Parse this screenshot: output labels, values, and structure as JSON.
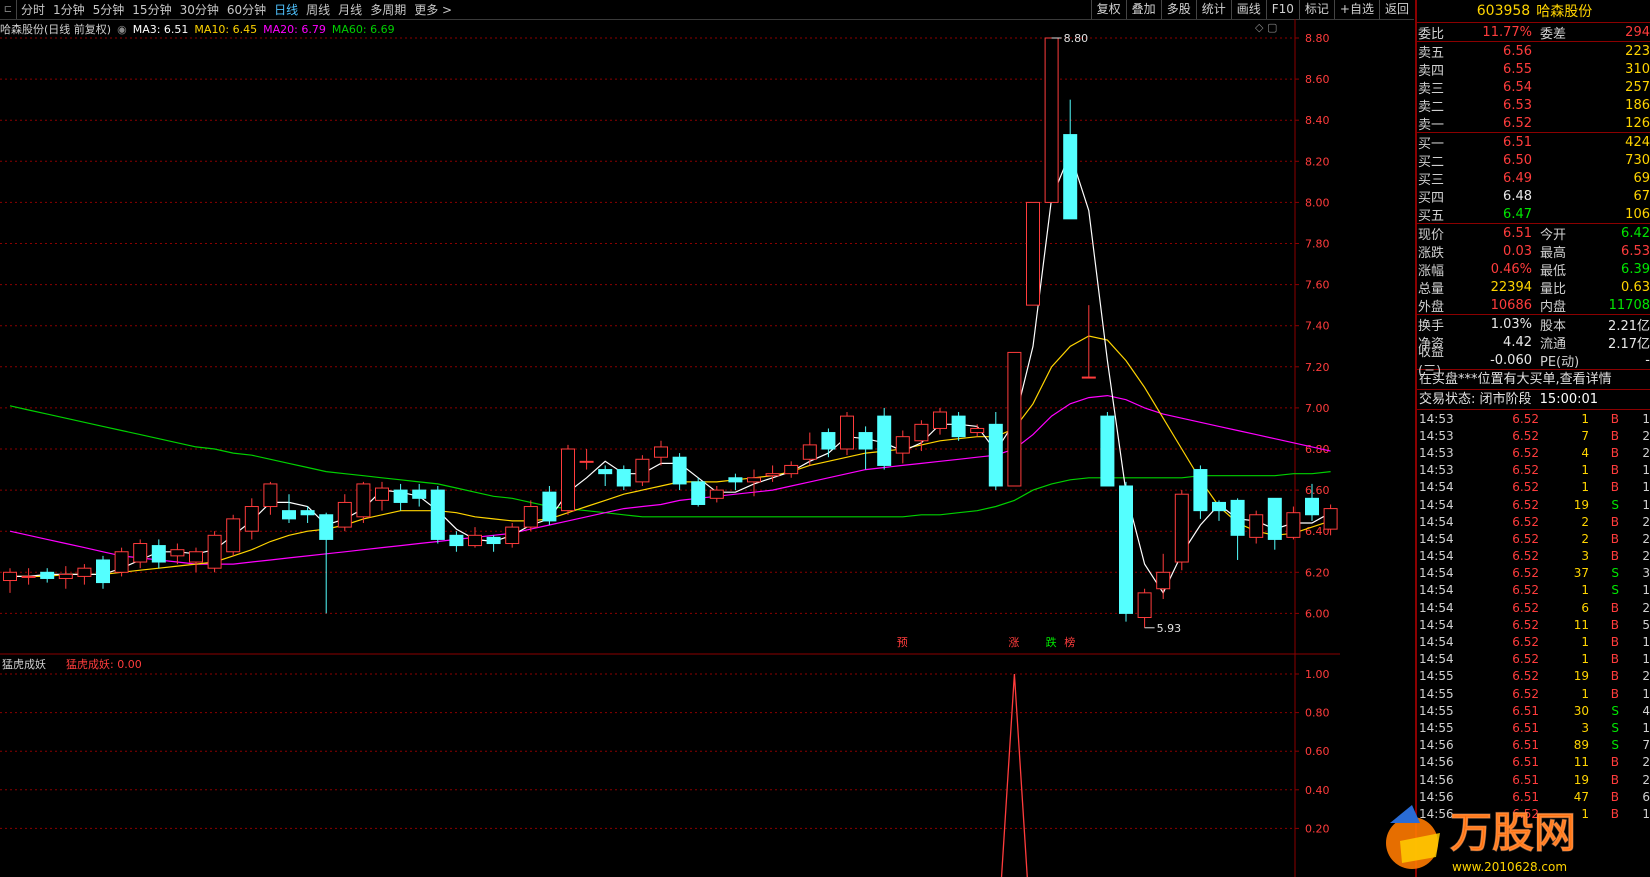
{
  "toolbar": {
    "periods": [
      "分时",
      "1分钟",
      "5分钟",
      "15分钟",
      "30分钟",
      "60分钟",
      "日线",
      "周线",
      "月线",
      "多周期",
      "更多 >"
    ],
    "active_period": "日线",
    "tools": [
      "复权",
      "叠加",
      "多股",
      "统计",
      "画线",
      "F10",
      "标记",
      "+自选",
      "返回"
    ]
  },
  "info": {
    "title": "哈森股份(日线 前复权)",
    "ma3": "MA3: 6.51",
    "ma10": "MA10: 6.45",
    "ma20": "MA20: 6.79",
    "ma60": "MA60: 6.69"
  },
  "indicator": {
    "name": "猛虎成妖",
    "label": "猛虎成妖: 0.00"
  },
  "colors": {
    "up": "#ff3c3c",
    "down": "#54ffff",
    "ma3": "#ffffff",
    "ma10": "#ffd400",
    "ma20": "#ff00ff",
    "ma60": "#00d000",
    "grid": "#8b0000"
  },
  "chart_data": {
    "type": "candlestick",
    "ylim": [
      5.93,
      8.8
    ],
    "yticks": [
      "8.80",
      "8.60",
      "8.40",
      "8.20",
      "8.00",
      "7.80",
      "7.60",
      "7.40",
      "7.20",
      "7.00",
      "6.80",
      "6.60",
      "6.40",
      "6.20",
      "6.00"
    ],
    "max_label": "8.80",
    "min_label": "5.93",
    "signals": [
      {
        "text": "预",
        "color": "#ff3c3c",
        "idx": 48
      },
      {
        "text": "涨",
        "color": "#ff3c3c",
        "idx": 54
      },
      {
        "text": "跌",
        "color": "#00e600",
        "idx": 56
      },
      {
        "text": "榜",
        "color": "#ff3c3c",
        "idx": 57
      }
    ],
    "candles": [
      [
        6.16,
        6.2,
        6.1,
        6.22
      ],
      [
        6.18,
        6.18,
        6.14,
        6.22
      ],
      [
        6.2,
        6.17,
        6.15,
        6.22
      ],
      [
        6.17,
        6.19,
        6.12,
        6.23
      ],
      [
        6.18,
        6.22,
        6.14,
        6.24
      ],
      [
        6.26,
        6.15,
        6.12,
        6.28
      ],
      [
        6.2,
        6.3,
        6.18,
        6.32
      ],
      [
        6.25,
        6.34,
        6.22,
        6.36
      ],
      [
        6.33,
        6.25,
        6.22,
        6.36
      ],
      [
        6.28,
        6.31,
        6.24,
        6.34
      ],
      [
        6.25,
        6.3,
        6.2,
        6.32
      ],
      [
        6.22,
        6.38,
        6.2,
        6.4
      ],
      [
        6.3,
        6.46,
        6.28,
        6.48
      ],
      [
        6.4,
        6.52,
        6.36,
        6.56
      ],
      [
        6.52,
        6.63,
        6.48,
        6.64
      ],
      [
        6.5,
        6.46,
        6.44,
        6.58
      ],
      [
        6.5,
        6.48,
        6.44,
        6.52
      ],
      [
        6.48,
        6.36,
        6.0,
        6.49
      ],
      [
        6.42,
        6.54,
        6.4,
        6.58
      ],
      [
        6.47,
        6.63,
        6.44,
        6.64
      ],
      [
        6.55,
        6.61,
        6.5,
        6.64
      ],
      [
        6.6,
        6.54,
        6.5,
        6.63
      ],
      [
        6.6,
        6.56,
        6.52,
        6.63
      ],
      [
        6.6,
        6.36,
        6.34,
        6.62
      ],
      [
        6.38,
        6.33,
        6.3,
        6.4
      ],
      [
        6.33,
        6.38,
        6.32,
        6.42
      ],
      [
        6.37,
        6.34,
        6.3,
        6.38
      ],
      [
        6.34,
        6.42,
        6.32,
        6.44
      ],
      [
        6.42,
        6.52,
        6.4,
        6.55
      ],
      [
        6.59,
        6.45,
        6.43,
        6.62
      ],
      [
        6.5,
        6.8,
        6.48,
        6.82
      ],
      [
        6.74,
        6.74,
        6.7,
        6.8
      ],
      [
        6.7,
        6.68,
        6.62,
        6.72
      ],
      [
        6.7,
        6.62,
        6.6,
        6.72
      ],
      [
        6.64,
        6.75,
        6.62,
        6.77
      ],
      [
        6.76,
        6.81,
        6.72,
        6.84
      ],
      [
        6.76,
        6.63,
        6.6,
        6.78
      ],
      [
        6.64,
        6.53,
        6.52,
        6.66
      ],
      [
        6.56,
        6.6,
        6.54,
        6.62
      ],
      [
        6.66,
        6.64,
        6.6,
        6.68
      ],
      [
        6.64,
        6.66,
        6.57,
        6.7
      ],
      [
        6.67,
        6.68,
        6.64,
        6.72
      ],
      [
        6.68,
        6.72,
        6.66,
        6.74
      ],
      [
        6.75,
        6.82,
        6.72,
        6.88
      ],
      [
        6.88,
        6.8,
        6.76,
        6.9
      ],
      [
        6.8,
        6.96,
        6.77,
        6.98
      ],
      [
        6.88,
        6.8,
        6.7,
        6.91
      ],
      [
        6.96,
        6.72,
        6.7,
        7.0
      ],
      [
        6.78,
        6.86,
        6.73,
        6.89
      ],
      [
        6.84,
        6.92,
        6.79,
        6.94
      ],
      [
        6.9,
        6.98,
        6.87,
        7.0
      ],
      [
        6.96,
        6.86,
        6.84,
        6.98
      ],
      [
        6.88,
        6.9,
        6.86,
        6.92
      ],
      [
        6.92,
        6.62,
        6.6,
        6.98
      ],
      [
        6.62,
        7.27,
        6.62,
        7.27
      ],
      [
        7.5,
        8.0,
        7.5,
        8.0
      ],
      [
        8.0,
        8.8,
        8.0,
        8.8
      ],
      [
        8.33,
        7.92,
        7.92,
        8.5
      ],
      [
        7.15,
        7.15,
        7.15,
        7.5
      ],
      [
        6.96,
        6.62,
        6.62,
        6.98
      ],
      [
        6.62,
        6.0,
        5.96,
        6.64
      ],
      [
        5.98,
        6.1,
        5.93,
        6.12
      ],
      [
        6.12,
        6.2,
        6.07,
        6.29
      ],
      [
        6.25,
        6.58,
        6.21,
        6.6
      ],
      [
        6.7,
        6.5,
        6.46,
        6.72
      ],
      [
        6.54,
        6.5,
        6.45,
        6.55
      ],
      [
        6.55,
        6.38,
        6.26,
        6.56
      ],
      [
        6.37,
        6.48,
        6.34,
        6.5
      ],
      [
        6.56,
        6.36,
        6.31,
        6.56
      ],
      [
        6.37,
        6.49,
        6.36,
        6.52
      ],
      [
        6.56,
        6.48,
        6.45,
        6.63
      ],
      [
        6.41,
        6.51,
        6.38,
        6.53
      ]
    ],
    "ma_series": {
      "ma3": [
        6.18,
        6.18,
        6.19,
        6.19,
        6.19,
        6.19,
        6.22,
        6.26,
        6.3,
        6.3,
        6.29,
        6.31,
        6.38,
        6.45,
        6.54,
        6.54,
        6.52,
        6.43,
        6.46,
        6.51,
        6.6,
        6.59,
        6.57,
        6.5,
        6.41,
        6.36,
        6.35,
        6.38,
        6.43,
        6.46,
        6.59,
        6.66,
        6.74,
        6.68,
        6.68,
        6.73,
        6.73,
        6.66,
        6.59,
        6.59,
        6.63,
        6.66,
        6.69,
        6.74,
        6.78,
        6.86,
        6.85,
        6.83,
        6.79,
        6.83,
        6.92,
        6.92,
        6.91,
        6.79,
        6.93,
        7.3,
        8.02,
        8.24,
        7.96,
        7.23,
        6.59,
        6.24,
        6.1,
        6.29,
        6.43,
        6.53,
        6.46,
        6.45,
        6.41,
        6.44,
        6.44,
        6.49
      ],
      "ma10": [
        6.18,
        6.18,
        6.18,
        6.19,
        6.19,
        6.19,
        6.2,
        6.21,
        6.22,
        6.23,
        6.24,
        6.25,
        6.28,
        6.31,
        6.35,
        6.38,
        6.4,
        6.41,
        6.43,
        6.46,
        6.48,
        6.5,
        6.5,
        6.5,
        6.49,
        6.47,
        6.46,
        6.45,
        6.45,
        6.46,
        6.49,
        6.52,
        6.55,
        6.58,
        6.6,
        6.62,
        6.64,
        6.64,
        6.64,
        6.65,
        6.66,
        6.67,
        6.69,
        6.72,
        6.74,
        6.76,
        6.78,
        6.79,
        6.8,
        6.82,
        6.84,
        6.85,
        6.86,
        6.86,
        6.9,
        7.02,
        7.2,
        7.3,
        7.35,
        7.33,
        7.23,
        7.1,
        6.95,
        6.8,
        6.65,
        6.52,
        6.44,
        6.4,
        6.38,
        6.39,
        6.42,
        6.45
      ],
      "ma20": [
        6.4,
        6.38,
        6.36,
        6.34,
        6.32,
        6.3,
        6.28,
        6.27,
        6.26,
        6.25,
        6.24,
        6.24,
        6.24,
        6.25,
        6.26,
        6.27,
        6.28,
        6.29,
        6.3,
        6.31,
        6.32,
        6.33,
        6.34,
        6.35,
        6.36,
        6.37,
        6.38,
        6.39,
        6.41,
        6.43,
        6.45,
        6.47,
        6.49,
        6.51,
        6.52,
        6.53,
        6.55,
        6.56,
        6.57,
        6.58,
        6.59,
        6.6,
        6.62,
        6.64,
        6.66,
        6.68,
        6.7,
        6.71,
        6.72,
        6.73,
        6.74,
        6.75,
        6.76,
        6.77,
        6.8,
        6.87,
        6.96,
        7.02,
        7.05,
        7.06,
        7.04,
        7.0,
        6.97,
        6.95,
        6.93,
        6.91,
        6.89,
        6.87,
        6.85,
        6.83,
        6.81,
        6.79
      ],
      "ma60": [
        7.01,
        6.99,
        6.97,
        6.95,
        6.93,
        6.91,
        6.89,
        6.87,
        6.85,
        6.83,
        6.81,
        6.8,
        6.78,
        6.77,
        6.75,
        6.73,
        6.71,
        6.69,
        6.68,
        6.67,
        6.66,
        6.65,
        6.64,
        6.63,
        6.61,
        6.59,
        6.57,
        6.56,
        6.54,
        6.52,
        6.51,
        6.5,
        6.49,
        6.48,
        6.47,
        6.47,
        6.47,
        6.47,
        6.47,
        6.47,
        6.47,
        6.47,
        6.47,
        6.47,
        6.47,
        6.47,
        6.47,
        6.47,
        6.47,
        6.48,
        6.48,
        6.49,
        6.5,
        6.52,
        6.55,
        6.6,
        6.63,
        6.65,
        6.66,
        6.66,
        6.66,
        6.66,
        6.66,
        6.66,
        6.67,
        6.67,
        6.67,
        6.67,
        6.67,
        6.68,
        6.68,
        6.69
      ]
    },
    "indicator": {
      "ylim": [
        0.2,
        1.0
      ],
      "yticks": [
        "1.00",
        "0.80",
        "0.60",
        "0.40",
        "0.20"
      ],
      "spike_index": 54,
      "spike_value": 1.0
    }
  },
  "quote": {
    "code": "603958",
    "name": "哈森股份",
    "weibi": {
      "label": "委比",
      "value": "11.77%",
      "label2": "委差",
      "value2": "294"
    },
    "sell": [
      {
        "label": "卖五",
        "price": "6.56",
        "vol": "223"
      },
      {
        "label": "卖四",
        "price": "6.55",
        "vol": "310"
      },
      {
        "label": "卖三",
        "price": "6.54",
        "vol": "257"
      },
      {
        "label": "卖二",
        "price": "6.53",
        "vol": "186"
      },
      {
        "label": "卖一",
        "price": "6.52",
        "vol": "126"
      }
    ],
    "buy": [
      {
        "label": "买一",
        "price": "6.51",
        "vol": "424"
      },
      {
        "label": "买二",
        "price": "6.50",
        "vol": "730"
      },
      {
        "label": "买三",
        "price": "6.49",
        "vol": "69"
      },
      {
        "label": "买四",
        "price": "6.48",
        "vol": "67"
      },
      {
        "label": "买五",
        "price": "6.47",
        "vol": "106"
      }
    ],
    "stats": [
      {
        "l1": "现价",
        "v1": "6.51",
        "l2": "今开",
        "v2": "6.42"
      },
      {
        "l1": "涨跌",
        "v1": "0.03",
        "l2": "最高",
        "v2": "6.53"
      },
      {
        "l1": "涨幅",
        "v1": "0.46%",
        "l2": "最低",
        "v2": "6.39"
      },
      {
        "l1": "总量",
        "v1": "22394",
        "l2": "量比",
        "v2": "0.63"
      },
      {
        "l1": "外盘",
        "v1": "10686",
        "l2": "内盘",
        "v2": "11708"
      }
    ],
    "stats2": [
      {
        "l1": "换手",
        "v1": "1.03%",
        "l2": "股本",
        "v2": "2.21亿"
      },
      {
        "l1": "净资",
        "v1": "4.42",
        "l2": "流通",
        "v2": "2.17亿"
      },
      {
        "l1": "收益(三)",
        "v1": "-0.060",
        "l2": "PE(动)",
        "v2": "-"
      }
    ],
    "notice": "在买盘***位置有大买单,查看详情",
    "status_label": "交易状态: 闭市阶段",
    "status_time": "15:00:01",
    "trades": [
      {
        "t": "14:53",
        "p": "6.52",
        "v": "1",
        "bs": "B",
        "n": "1"
      },
      {
        "t": "14:53",
        "p": "6.52",
        "v": "7",
        "bs": "B",
        "n": "2"
      },
      {
        "t": "14:53",
        "p": "6.52",
        "v": "4",
        "bs": "B",
        "n": "2"
      },
      {
        "t": "14:53",
        "p": "6.52",
        "v": "1",
        "bs": "B",
        "n": "1"
      },
      {
        "t": "14:54",
        "p": "6.52",
        "v": "1",
        "bs": "B",
        "n": "1"
      },
      {
        "t": "14:54",
        "p": "6.52",
        "v": "19",
        "bs": "S",
        "n": "1"
      },
      {
        "t": "14:54",
        "p": "6.52",
        "v": "2",
        "bs": "B",
        "n": "2"
      },
      {
        "t": "14:54",
        "p": "6.52",
        "v": "2",
        "bs": "B",
        "n": "2"
      },
      {
        "t": "14:54",
        "p": "6.52",
        "v": "3",
        "bs": "B",
        "n": "2"
      },
      {
        "t": "14:54",
        "p": "6.52",
        "v": "37",
        "bs": "S",
        "n": "3"
      },
      {
        "t": "14:54",
        "p": "6.52",
        "v": "1",
        "bs": "S",
        "n": "1"
      },
      {
        "t": "14:54",
        "p": "6.52",
        "v": "6",
        "bs": "B",
        "n": "2"
      },
      {
        "t": "14:54",
        "p": "6.52",
        "v": "11",
        "bs": "B",
        "n": "5"
      },
      {
        "t": "14:54",
        "p": "6.52",
        "v": "1",
        "bs": "B",
        "n": "1"
      },
      {
        "t": "14:54",
        "p": "6.52",
        "v": "1",
        "bs": "B",
        "n": "1"
      },
      {
        "t": "14:55",
        "p": "6.52",
        "v": "19",
        "bs": "B",
        "n": "2"
      },
      {
        "t": "14:55",
        "p": "6.52",
        "v": "1",
        "bs": "B",
        "n": "1"
      },
      {
        "t": "14:55",
        "p": "6.51",
        "v": "30",
        "bs": "S",
        "n": "4"
      },
      {
        "t": "14:55",
        "p": "6.51",
        "v": "3",
        "bs": "S",
        "n": "1"
      },
      {
        "t": "14:56",
        "p": "6.51",
        "v": "89",
        "bs": "S",
        "n": "7"
      },
      {
        "t": "14:56",
        "p": "6.51",
        "v": "11",
        "bs": "B",
        "n": "2"
      },
      {
        "t": "14:56",
        "p": "6.51",
        "v": "19",
        "bs": "B",
        "n": "2"
      },
      {
        "t": "14:56",
        "p": "6.51",
        "v": "47",
        "bs": "B",
        "n": "6"
      },
      {
        "t": "14:56",
        "p": "6.52",
        "v": "1",
        "bs": "B",
        "n": "1"
      }
    ]
  },
  "watermark": {
    "text": "万股网",
    "url": "www.2010628.com"
  }
}
